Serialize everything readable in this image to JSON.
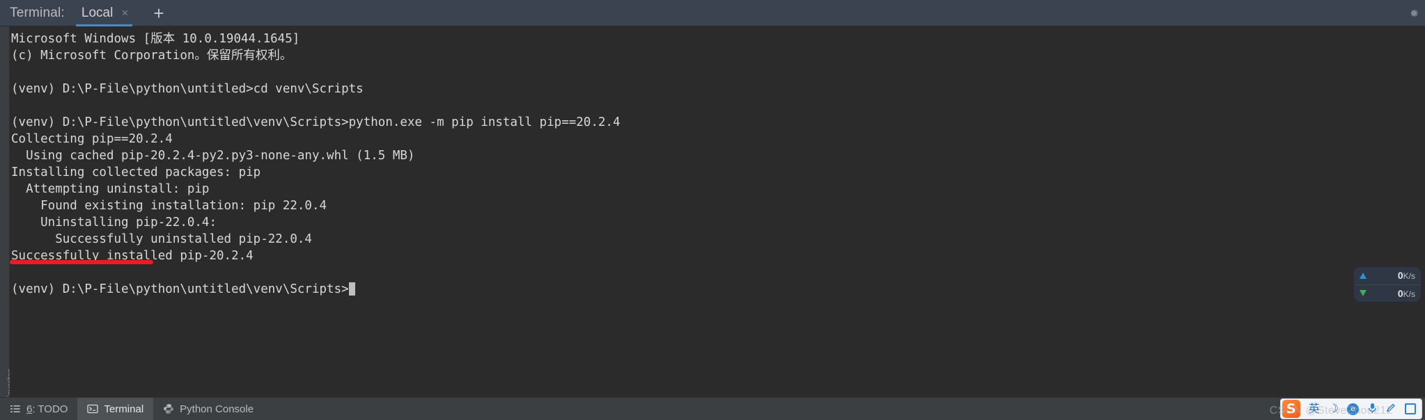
{
  "window": {
    "tabbar_label": "Terminal:",
    "gear_icon": "gear-icon"
  },
  "tabs": [
    {
      "name": "Local",
      "close_glyph": "×",
      "active": true
    }
  ],
  "tab_add_glyph": "+",
  "left_strip": {
    "vertical_label": "2: Favorites"
  },
  "terminal": {
    "lines": [
      "Microsoft Windows [版本 10.0.19044.1645]",
      "(c) Microsoft Corporation。保留所有权利。",
      "",
      "(venv) D:\\P-File\\python\\untitled>cd venv\\Scripts",
      "",
      "(venv) D:\\P-File\\python\\untitled\\venv\\Scripts>python.exe -m pip install pip==20.2.4",
      "Collecting pip==20.2.4",
      "  Using cached pip-20.2.4-py2.py3-none-any.whl (1.5 MB)",
      "Installing collected packages: pip",
      "  Attempting uninstall: pip",
      "    Found existing installation: pip 22.0.4",
      "    Uninstalling pip-22.0.4:",
      "      Successfully uninstalled pip-22.0.4",
      "Successfully installed pip-20.2.4",
      "",
      "(venv) D:\\P-File\\python\\untitled\\venv\\Scripts>"
    ],
    "prompt_line_index": 15,
    "annotation": {
      "type": "red-underline",
      "target_line": "Successfully installed pip-20.2.4",
      "color": "#ee1b24"
    }
  },
  "network_speed": {
    "upload": {
      "value": "0",
      "unit": "K/s",
      "arrow": "up-arrow-icon",
      "color": "#2e8fd6"
    },
    "download": {
      "value": "0",
      "unit": "K/s",
      "arrow": "down-arrow-icon",
      "color": "#3fae52"
    }
  },
  "statusbar": {
    "items": [
      {
        "label_prefix": "6",
        "label_suffix": ": TODO",
        "icon": "todo-list-icon",
        "active": false
      },
      {
        "label_prefix": "",
        "label_suffix": "Terminal",
        "icon": "terminal-icon",
        "active": true
      },
      {
        "label_prefix": "",
        "label_suffix": "Python Console",
        "icon": "python-icon",
        "active": false
      }
    ]
  },
  "ime": {
    "logo_text": "S",
    "mode_label": "英",
    "moon_glyph": "☽",
    "circle_glyph": "e",
    "mic_glyph": "ᴜ",
    "pen_glyph": "✒",
    "box_glyph": ""
  },
  "watermark": "CSDN @SteveZhou212",
  "colors": {
    "tabbar_bg": "#3c4350",
    "terminal_bg": "#2b2b2b",
    "terminal_fg": "#d8d8d8",
    "tab_accent": "#4a88c7",
    "statusbar_bg": "#3c3f41",
    "annotation_red": "#ee1b24"
  }
}
